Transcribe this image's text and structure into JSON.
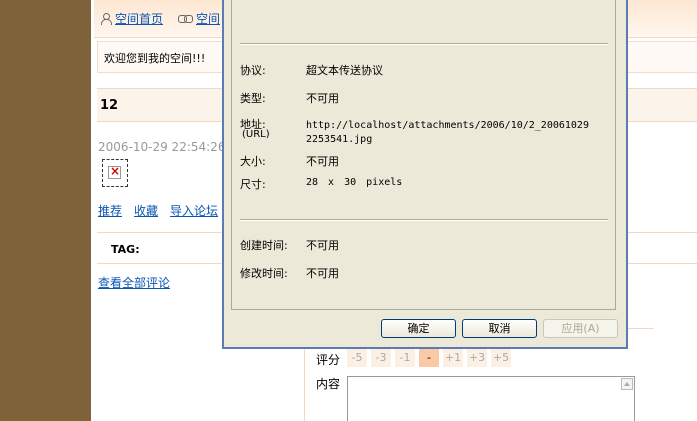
{
  "nav": {
    "home_link": "空间首页",
    "second_link": "空间"
  },
  "welcome": "欢迎您到我的空间!!!",
  "post": {
    "title": "12",
    "date": "2006-10-29 22:54:26",
    "links": [
      "推荐",
      "收藏",
      "导入论坛"
    ],
    "tag_label": "TAG:",
    "view_all_comments": "查看全部评论"
  },
  "comment_form": {
    "rating_label": "评分",
    "rating_options": [
      "-5",
      "-3",
      "-1",
      "-",
      "+1",
      "+3",
      "+5"
    ],
    "rating_selected": "-",
    "content_label": "内容"
  },
  "dialog": {
    "properties": {
      "protocol_label": "协议:",
      "protocol_value": "超文本传送协议",
      "type_label": "类型:",
      "type_value": "不可用",
      "address_label": "地址:",
      "address_sub_label": "(URL)",
      "address_line1": "http://localhost/attachments/2006/10/2_20061029",
      "address_line2": "2253541.jpg",
      "size_label": "大小:",
      "size_value": "不可用",
      "dimensions_label": "尺寸:",
      "dimensions_value": "28 x 30 pixels",
      "created_label": "创建时间:",
      "created_value": "不可用",
      "modified_label": "修改时间:",
      "modified_value": "不可用"
    },
    "buttons": {
      "ok": "确定",
      "cancel": "取消",
      "apply": "应用(A)"
    }
  }
}
